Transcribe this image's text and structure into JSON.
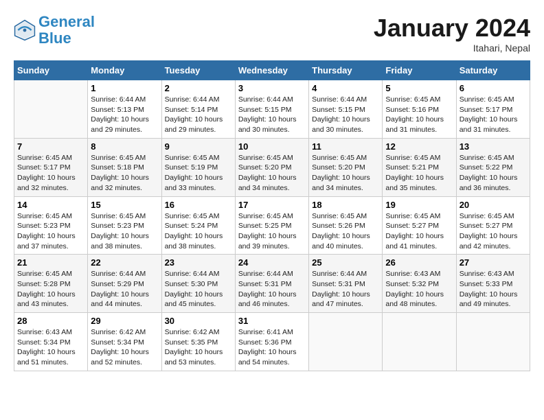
{
  "header": {
    "logo_line1": "General",
    "logo_line2": "Blue",
    "month_title": "January 2024",
    "subtitle": "Itahari, Nepal"
  },
  "weekdays": [
    "Sunday",
    "Monday",
    "Tuesday",
    "Wednesday",
    "Thursday",
    "Friday",
    "Saturday"
  ],
  "weeks": [
    [
      {
        "day": "",
        "detail": ""
      },
      {
        "day": "1",
        "detail": "Sunrise: 6:44 AM\nSunset: 5:13 PM\nDaylight: 10 hours\nand 29 minutes."
      },
      {
        "day": "2",
        "detail": "Sunrise: 6:44 AM\nSunset: 5:14 PM\nDaylight: 10 hours\nand 29 minutes."
      },
      {
        "day": "3",
        "detail": "Sunrise: 6:44 AM\nSunset: 5:15 PM\nDaylight: 10 hours\nand 30 minutes."
      },
      {
        "day": "4",
        "detail": "Sunrise: 6:44 AM\nSunset: 5:15 PM\nDaylight: 10 hours\nand 30 minutes."
      },
      {
        "day": "5",
        "detail": "Sunrise: 6:45 AM\nSunset: 5:16 PM\nDaylight: 10 hours\nand 31 minutes."
      },
      {
        "day": "6",
        "detail": "Sunrise: 6:45 AM\nSunset: 5:17 PM\nDaylight: 10 hours\nand 31 minutes."
      }
    ],
    [
      {
        "day": "7",
        "detail": "Sunrise: 6:45 AM\nSunset: 5:17 PM\nDaylight: 10 hours\nand 32 minutes."
      },
      {
        "day": "8",
        "detail": "Sunrise: 6:45 AM\nSunset: 5:18 PM\nDaylight: 10 hours\nand 32 minutes."
      },
      {
        "day": "9",
        "detail": "Sunrise: 6:45 AM\nSunset: 5:19 PM\nDaylight: 10 hours\nand 33 minutes."
      },
      {
        "day": "10",
        "detail": "Sunrise: 6:45 AM\nSunset: 5:20 PM\nDaylight: 10 hours\nand 34 minutes."
      },
      {
        "day": "11",
        "detail": "Sunrise: 6:45 AM\nSunset: 5:20 PM\nDaylight: 10 hours\nand 34 minutes."
      },
      {
        "day": "12",
        "detail": "Sunrise: 6:45 AM\nSunset: 5:21 PM\nDaylight: 10 hours\nand 35 minutes."
      },
      {
        "day": "13",
        "detail": "Sunrise: 6:45 AM\nSunset: 5:22 PM\nDaylight: 10 hours\nand 36 minutes."
      }
    ],
    [
      {
        "day": "14",
        "detail": "Sunrise: 6:45 AM\nSunset: 5:23 PM\nDaylight: 10 hours\nand 37 minutes."
      },
      {
        "day": "15",
        "detail": "Sunrise: 6:45 AM\nSunset: 5:23 PM\nDaylight: 10 hours\nand 38 minutes."
      },
      {
        "day": "16",
        "detail": "Sunrise: 6:45 AM\nSunset: 5:24 PM\nDaylight: 10 hours\nand 38 minutes."
      },
      {
        "day": "17",
        "detail": "Sunrise: 6:45 AM\nSunset: 5:25 PM\nDaylight: 10 hours\nand 39 minutes."
      },
      {
        "day": "18",
        "detail": "Sunrise: 6:45 AM\nSunset: 5:26 PM\nDaylight: 10 hours\nand 40 minutes."
      },
      {
        "day": "19",
        "detail": "Sunrise: 6:45 AM\nSunset: 5:27 PM\nDaylight: 10 hours\nand 41 minutes."
      },
      {
        "day": "20",
        "detail": "Sunrise: 6:45 AM\nSunset: 5:27 PM\nDaylight: 10 hours\nand 42 minutes."
      }
    ],
    [
      {
        "day": "21",
        "detail": "Sunrise: 6:45 AM\nSunset: 5:28 PM\nDaylight: 10 hours\nand 43 minutes."
      },
      {
        "day": "22",
        "detail": "Sunrise: 6:44 AM\nSunset: 5:29 PM\nDaylight: 10 hours\nand 44 minutes."
      },
      {
        "day": "23",
        "detail": "Sunrise: 6:44 AM\nSunset: 5:30 PM\nDaylight: 10 hours\nand 45 minutes."
      },
      {
        "day": "24",
        "detail": "Sunrise: 6:44 AM\nSunset: 5:31 PM\nDaylight: 10 hours\nand 46 minutes."
      },
      {
        "day": "25",
        "detail": "Sunrise: 6:44 AM\nSunset: 5:31 PM\nDaylight: 10 hours\nand 47 minutes."
      },
      {
        "day": "26",
        "detail": "Sunrise: 6:43 AM\nSunset: 5:32 PM\nDaylight: 10 hours\nand 48 minutes."
      },
      {
        "day": "27",
        "detail": "Sunrise: 6:43 AM\nSunset: 5:33 PM\nDaylight: 10 hours\nand 49 minutes."
      }
    ],
    [
      {
        "day": "28",
        "detail": "Sunrise: 6:43 AM\nSunset: 5:34 PM\nDaylight: 10 hours\nand 51 minutes."
      },
      {
        "day": "29",
        "detail": "Sunrise: 6:42 AM\nSunset: 5:34 PM\nDaylight: 10 hours\nand 52 minutes."
      },
      {
        "day": "30",
        "detail": "Sunrise: 6:42 AM\nSunset: 5:35 PM\nDaylight: 10 hours\nand 53 minutes."
      },
      {
        "day": "31",
        "detail": "Sunrise: 6:41 AM\nSunset: 5:36 PM\nDaylight: 10 hours\nand 54 minutes."
      },
      {
        "day": "",
        "detail": ""
      },
      {
        "day": "",
        "detail": ""
      },
      {
        "day": "",
        "detail": ""
      }
    ]
  ]
}
